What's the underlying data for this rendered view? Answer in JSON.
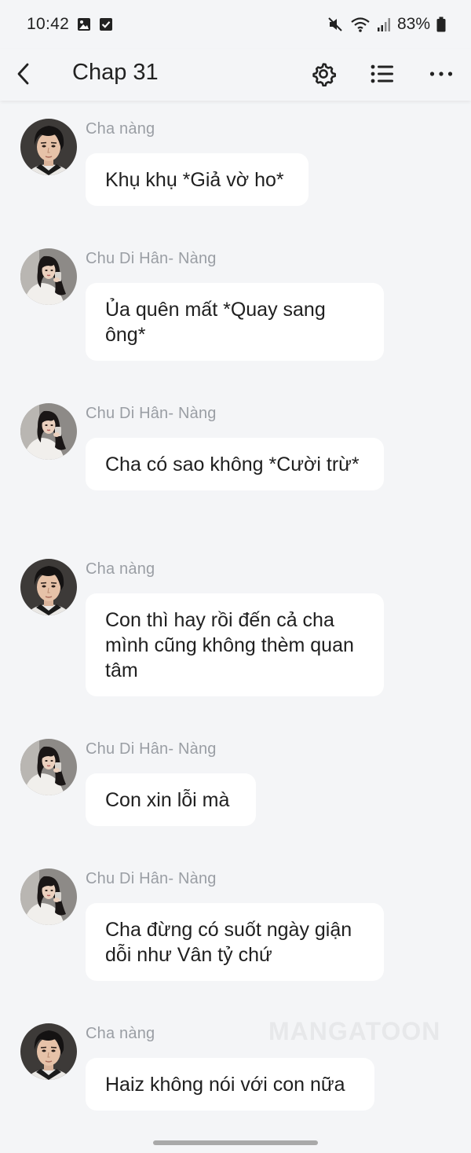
{
  "status": {
    "time": "10:42",
    "battery": "83%"
  },
  "nav": {
    "title": "Chap 31"
  },
  "messages": [
    {
      "sender": "Cha nàng",
      "text": "Khụ khụ *Giả vờ ho*",
      "avatar": "male-avatar"
    },
    {
      "sender": "Chu Di Hân- Nàng",
      "text": "Ủa quên mất *Quay sang ông*",
      "avatar": "female-avatar"
    },
    {
      "sender": "Chu Di Hân- Nàng",
      "text": "Cha có sao không *Cười trừ*",
      "avatar": "female-avatar"
    },
    {
      "sender": "Cha nàng",
      "text": "Con thì hay rồi đến cả cha mình cũng không thèm quan tâm",
      "avatar": "male-avatar"
    },
    {
      "sender": "Chu Di Hân- Nàng",
      "text": "Con xin lỗi mà",
      "avatar": "female-avatar"
    },
    {
      "sender": "Chu Di Hân- Nàng",
      "text": "Cha đừng có suốt ngày giận dỗi như Vân tỷ chứ",
      "avatar": "female-avatar"
    },
    {
      "sender": "Cha nàng",
      "text": "Haiz không nói với con nữa",
      "avatar": "male-avatar"
    }
  ],
  "watermark": "MANGATOON",
  "colors": {
    "background": "#f4f5f7",
    "bubble": "#ffffff",
    "sender_text": "#9a9ea4",
    "message_text": "#202020"
  }
}
